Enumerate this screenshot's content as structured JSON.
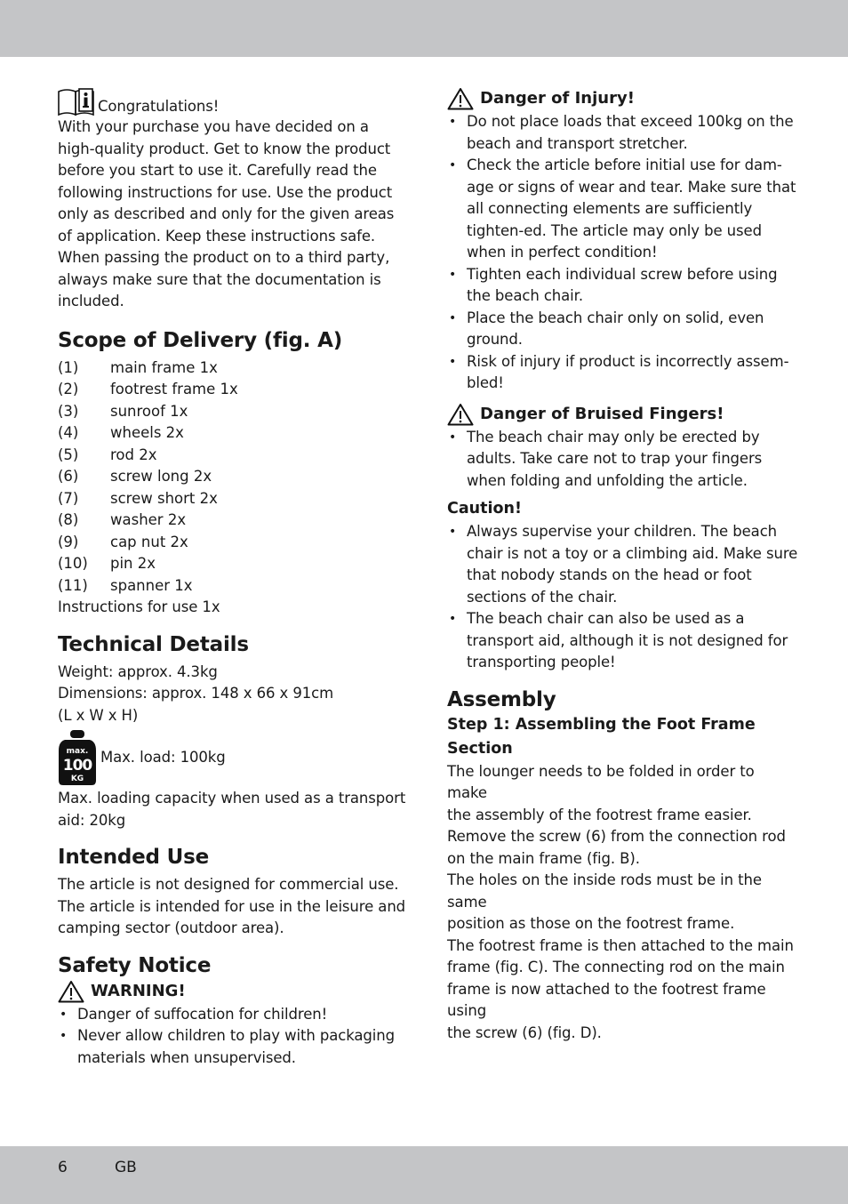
{
  "footer": {
    "page_number": "6",
    "language": "GB"
  },
  "intro": {
    "title": "Congratulations!",
    "lines": [
      "With your purchase you have decided on a",
      "high-quality product. Get to know the product",
      "before you start to use it. Carefully read the",
      "following instructions for use. Use the product",
      "only as described and only for the given areas",
      "of application. Keep these instructions safe.",
      "When passing the product on to a third party,",
      "always make sure that the documentation is",
      "included."
    ]
  },
  "scope": {
    "heading": "Scope of Delivery (fig. A)",
    "items": [
      {
        "num": "(1)",
        "text": "main frame 1x"
      },
      {
        "num": "(2)",
        "text": "footrest frame 1x"
      },
      {
        "num": "(3)",
        "text": "sunroof 1x"
      },
      {
        "num": "(4)",
        "text": "wheels 2x"
      },
      {
        "num": "(5)",
        "text": "rod 2x"
      },
      {
        "num": "(6)",
        "text": "screw long 2x"
      },
      {
        "num": "(7)",
        "text": "screw short 2x"
      },
      {
        "num": "(8)",
        "text": "washer 2x"
      },
      {
        "num": "(9)",
        "text": "cap nut 2x"
      },
      {
        "num": "(10)",
        "text": "pin 2x"
      },
      {
        "num": "(11)",
        "text": "spanner 1x"
      }
    ],
    "footer_line": "Instructions for use 1x"
  },
  "technical": {
    "heading": "Technical Details",
    "weight": "Weight: approx. 4.3kg",
    "dimensions": "Dimensions: approx. 148 x 66 x 91cm",
    "dimensions_note": "(L x W x H)",
    "weight_icon": {
      "top": "max.",
      "value": "100",
      "unit": "KG"
    },
    "max_load": "Max. load: 100kg",
    "transport_lines": [
      "Max. loading capacity when used as a transport",
      "aid: 20kg"
    ]
  },
  "intended_use": {
    "heading": "Intended Use",
    "lines": [
      "The article is not designed for commercial use.",
      "The article is intended for use in the leisure and",
      "camping sector (outdoor area)."
    ]
  },
  "safety": {
    "heading": "Safety Notice",
    "warning_title": "WARNING!",
    "warning_items": [
      "Danger of suffocation for children!",
      "Never allow children to play with packaging materials when unsupervised."
    ]
  },
  "danger_injury": {
    "title": "Danger of Injury!",
    "items": [
      "Do not place loads that exceed 100kg on the beach and transport stretcher.",
      "Check the article before initial use for dam-age or signs of wear and tear. Make sure that all connecting elements are sufficiently tighten-ed. The article may only be used when in perfect condition!",
      "Tighten each individual screw before using the beach chair.",
      "Place the beach chair only on solid, even ground.",
      "Risk of injury if product is incorrectly assem-bled!"
    ]
  },
  "danger_fingers": {
    "title": "Danger of Bruised Fingers!",
    "items": [
      "The beach chair may only be erected by adults. Take care not to trap your fingers when folding and unfolding the article."
    ]
  },
  "caution": {
    "title": "Caution!",
    "items": [
      "Always supervise your children. The beach chair is not a toy or a climbing aid. Make sure that nobody stands on the head or foot sections of the chair.",
      "The beach chair can also be used as a transport aid, although it is not designed for transporting people!"
    ]
  },
  "assembly": {
    "heading": "Assembly",
    "step_title": "Step 1: Assembling the Foot Frame Section",
    "lines": [
      "The lounger needs to be folded in order to make",
      "the assembly of the footrest frame easier.",
      "Remove the screw (6) from the connection rod",
      "on the main frame (fig. B).",
      "The holes on the inside rods must be in the same",
      "position as those on the footrest frame.",
      "The footrest frame is then attached to the main",
      "frame (fig. C). The connecting rod on the main",
      "frame is now attached to the footrest frame using",
      "the screw (6) (fig. D)."
    ]
  }
}
